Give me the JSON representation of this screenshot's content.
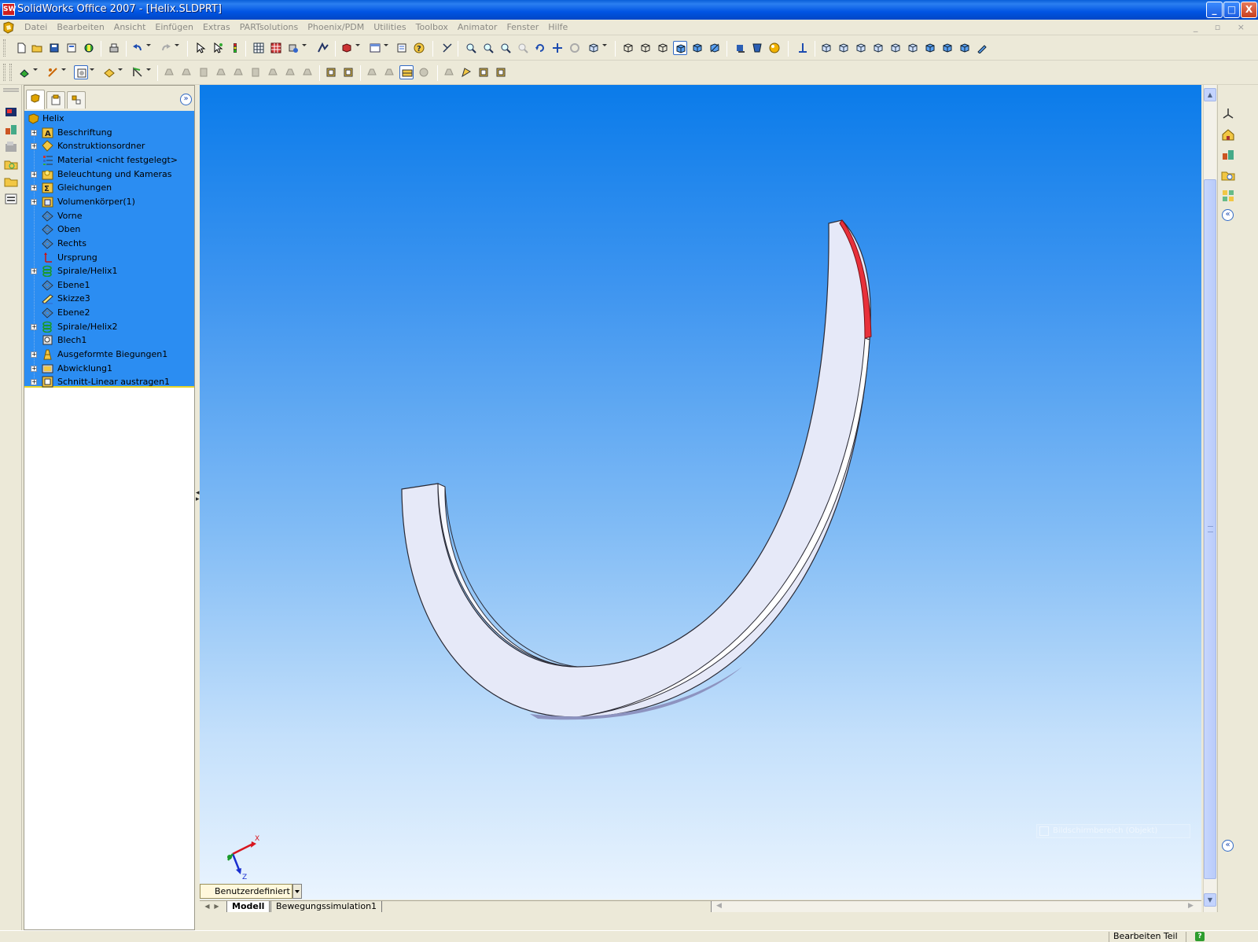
{
  "window": {
    "title": "SolidWorks Office 2007 - [Helix.SLDPRT]",
    "app_icon_label": "SW",
    "minimize_label": "_",
    "maximize_label": "□",
    "close_label": "X"
  },
  "menubar": {
    "items": [
      "Datei",
      "Bearbeiten",
      "Ansicht",
      "Einfügen",
      "Extras",
      "PARTsolutions",
      "Phoenix/PDM",
      "Utilities",
      "Toolbox",
      "Animator",
      "Fenster",
      "Hilfe"
    ],
    "mdi_controls": "_ ▫ ×"
  },
  "feature_manager": {
    "expand_label": "»",
    "tree": [
      {
        "label": "Helix",
        "icon": "part-icon",
        "root": true
      },
      {
        "label": "Beschriftung",
        "icon": "annotations-icon",
        "expand": true
      },
      {
        "label": "Konstruktionsordner",
        "icon": "design-binder-icon",
        "expand": true
      },
      {
        "label": "Material <nicht festgelegt>",
        "icon": "material-icon",
        "expand": false
      },
      {
        "label": "Beleuchtung und Kameras",
        "icon": "lights-icon",
        "expand": true
      },
      {
        "label": "Gleichungen",
        "icon": "equations-icon",
        "expand": true
      },
      {
        "label": "Volumenkörper(1)",
        "icon": "solid-bodies-icon",
        "expand": true
      },
      {
        "label": "Vorne",
        "icon": "plane-icon",
        "expand": false
      },
      {
        "label": "Oben",
        "icon": "plane-icon",
        "expand": false
      },
      {
        "label": "Rechts",
        "icon": "plane-icon",
        "expand": false
      },
      {
        "label": "Ursprung",
        "icon": "origin-icon",
        "expand": false
      },
      {
        "label": "Spirale/Helix1",
        "icon": "helix-icon",
        "expand": true
      },
      {
        "label": "Ebene1",
        "icon": "plane-icon",
        "expand": false
      },
      {
        "label": "Skizze3",
        "icon": "sketch-icon",
        "expand": false
      },
      {
        "label": "Ebene2",
        "icon": "plane-icon",
        "expand": false
      },
      {
        "label": "Spirale/Helix2",
        "icon": "helix-icon",
        "expand": true
      },
      {
        "label": "Blech1",
        "icon": "sheet-metal-icon",
        "expand": false
      },
      {
        "label": "Ausgeformte Biegungen1",
        "icon": "lofted-bend-icon",
        "expand": true
      },
      {
        "label": "Abwicklung1",
        "icon": "flat-pattern-icon",
        "expand": true
      },
      {
        "label": "Schnitt-Linear austragen1",
        "icon": "cut-extrude-icon",
        "expand": true
      }
    ]
  },
  "viewport": {
    "view_orientation": "Benutzerdefiniert",
    "triad_x": "X",
    "triad_z": "Z",
    "notice": "Bildschirmbereich (Objekt)",
    "colors": {
      "top": "#0a7bea",
      "bottom": "#eaf4fe",
      "part_face": "#e6eaf8",
      "highlight": "#e8303a"
    }
  },
  "bottom_tabs": {
    "tabs": [
      {
        "label": "Modell",
        "active": true
      },
      {
        "label": "Bewegungssimulation1",
        "active": false
      }
    ],
    "arrow_left": "◀",
    "arrow_right": "▶"
  },
  "statusbar": {
    "mode": "Bearbeiten Teil",
    "help": "?"
  }
}
